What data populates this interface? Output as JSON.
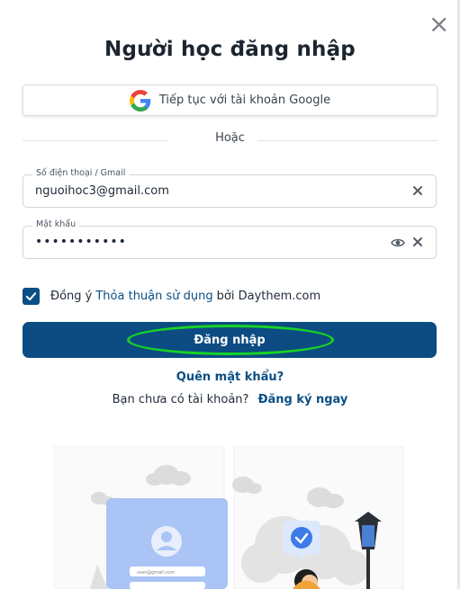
{
  "modal": {
    "title": "Người học đăng nhập",
    "close_symbol": "×"
  },
  "google": {
    "label": "Tiếp tục với tài khoản Google",
    "icon": "google-g-icon"
  },
  "divider": {
    "text": "Hoặc"
  },
  "phone_field": {
    "label": "Số điện thoại / Gmail",
    "value": "nguoihoc3@gmail.com"
  },
  "password_field": {
    "label": "Mật khẩu",
    "value": "•••••••••••"
  },
  "agreement": {
    "checked": true,
    "prefix": "Đồng ý",
    "link": "Thỏa thuận sử dụng",
    "suffix": "bởi Daythem.com"
  },
  "login_button": {
    "label": "Đăng nhập"
  },
  "forgot": {
    "label": "Quên mật khẩu?"
  },
  "signup": {
    "prompt": "Bạn chưa có tài khoản?",
    "link": "Đăng ký ngay"
  },
  "colors": {
    "primary": "#0c4c82",
    "highlight_ring": "#19d324",
    "illustration_blue": "#a9c4f5"
  },
  "illustration": {
    "mock_field_text": "user@gmail.com"
  }
}
